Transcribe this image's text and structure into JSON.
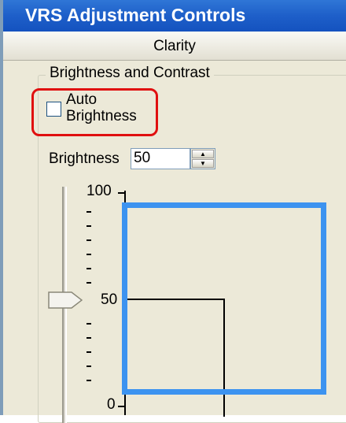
{
  "window": {
    "title": "VRS Adjustment Controls"
  },
  "tabs": {
    "clarity": "Clarity"
  },
  "group": {
    "legend": "Brightness and Contrast",
    "auto_brightness_label": "Auto\nBrightness",
    "auto_brightness_checked": false,
    "brightness_label": "Brightness",
    "brightness_value": "50"
  },
  "slider": {
    "value": 50,
    "labels": [
      "100",
      "50",
      "0"
    ]
  },
  "colors": {
    "title_bar": "#1E5FC9",
    "highlight_red": "#E01010",
    "highlight_blue": "#3C93F0",
    "panel_bg": "#ECE9D8"
  }
}
